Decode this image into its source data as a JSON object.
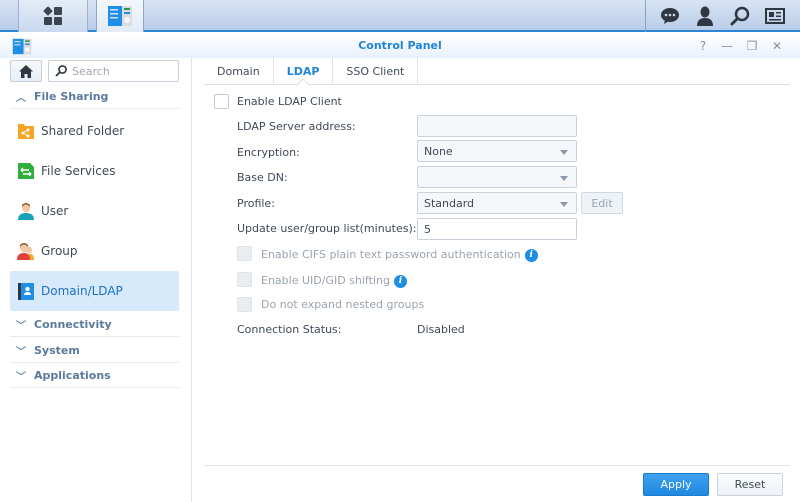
{
  "taskbar": {
    "main_menu_icon": "grid-icon",
    "open_app_icon": "control-panel-icon",
    "right_icons": [
      "notification-chat-icon",
      "user-icon",
      "search-icon",
      "widgets-icon"
    ]
  },
  "window": {
    "title": "Control Panel",
    "controls": {
      "help": "?",
      "minimize": "—",
      "restore": "❐",
      "close": "✕"
    }
  },
  "sidebar": {
    "search_placeholder": "Search",
    "categories": [
      {
        "label": "File Sharing",
        "expanded": true
      },
      {
        "label": "Connectivity",
        "expanded": false
      },
      {
        "label": "System",
        "expanded": false
      },
      {
        "label": "Applications",
        "expanded": false
      }
    ],
    "items": [
      {
        "label": "Shared Folder",
        "icon": "shared-folder-icon"
      },
      {
        "label": "File Services",
        "icon": "file-services-icon"
      },
      {
        "label": "User",
        "icon": "user-icon"
      },
      {
        "label": "Group",
        "icon": "group-icon"
      },
      {
        "label": "Domain/LDAP",
        "icon": "domain-ldap-icon",
        "active": true
      }
    ]
  },
  "tabs": [
    {
      "label": "Domain"
    },
    {
      "label": "LDAP",
      "active": true
    },
    {
      "label": "SSO Client"
    }
  ],
  "form": {
    "enable_ldap_client": {
      "label": "Enable LDAP Client",
      "checked": false
    },
    "server_address": {
      "label": "LDAP Server address:",
      "value": ""
    },
    "encryption": {
      "label": "Encryption:",
      "value": "None"
    },
    "base_dn": {
      "label": "Base DN:",
      "value": ""
    },
    "profile": {
      "label": "Profile:",
      "value": "Standard",
      "edit_label": "Edit"
    },
    "update_interval": {
      "label": "Update user/group list(minutes):",
      "value": "5"
    },
    "cifs_plain": {
      "label": "Enable CIFS plain text password authentication",
      "checked": false,
      "disabled": true
    },
    "uid_gid_shift": {
      "label": "Enable UID/GID shifting",
      "checked": false,
      "disabled": true
    },
    "no_nested": {
      "label": "Do not expand nested groups",
      "checked": false,
      "disabled": true
    },
    "connection_status": {
      "label": "Connection Status:",
      "value": "Disabled"
    },
    "info_glyph": "i"
  },
  "footer": {
    "apply_label": "Apply",
    "reset_label": "Reset"
  },
  "colors": {
    "accent": "#1f85d6",
    "active_bg": "#d6eafc",
    "apply_bg": "#2a93e6"
  }
}
